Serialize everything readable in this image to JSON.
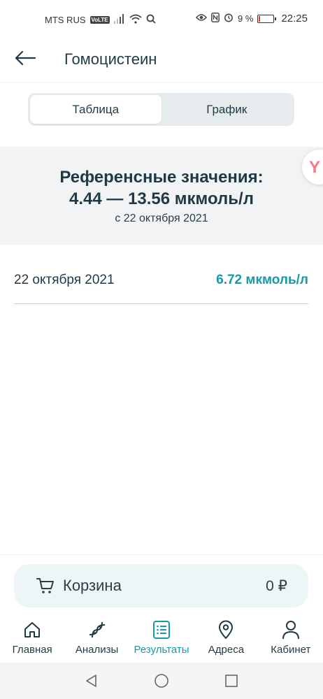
{
  "status_bar": {
    "carrier": "MTS RUS",
    "volte": "VoLTE",
    "battery_percent": "9 %",
    "battery_level": 0.09,
    "time": "22:25"
  },
  "header": {
    "title": "Гомоцистеин"
  },
  "segmented": {
    "table_label": "Таблица",
    "chart_label": "График",
    "selected": "table"
  },
  "reference": {
    "title": "Референсные значения:",
    "range": "4.44 — 13.56 мкмоль/л",
    "since": "с 22 октября 2021"
  },
  "results": [
    {
      "date": "22 октября 2021",
      "value": "6.72 мкмоль/л"
    }
  ],
  "cart": {
    "label": "Корзина",
    "total": "0 ₽"
  },
  "tabbar": {
    "items": [
      {
        "label": "Главная",
        "icon": "home-icon",
        "active": false
      },
      {
        "label": "Анализы",
        "icon": "dna-icon",
        "active": false
      },
      {
        "label": "Результаты",
        "icon": "results-list-icon",
        "active": true
      },
      {
        "label": "Адреса",
        "icon": "location-pin-icon",
        "active": false
      },
      {
        "label": "Кабинет",
        "icon": "user-icon",
        "active": false
      }
    ]
  },
  "colors": {
    "accent": "#179aa8",
    "text": "#1f3a44",
    "reference_bg": "#f2f3f4",
    "cart_bg": "#eef5f7"
  }
}
